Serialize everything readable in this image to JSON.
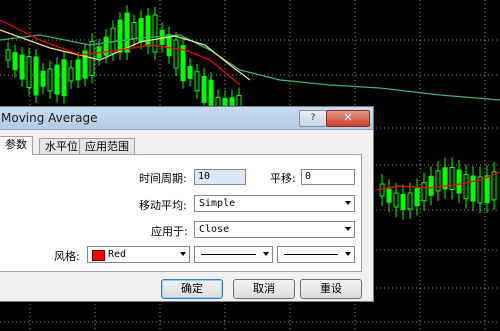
{
  "dialog": {
    "title": "Moving Average",
    "help_label": "?",
    "close_label": "✕",
    "tabs": [
      {
        "label": "参数"
      },
      {
        "label": "水平位"
      },
      {
        "label": "应用范围"
      }
    ],
    "period_label": "时间周期:",
    "period_value": "10",
    "shift_label": "平移:",
    "shift_value": "0",
    "method_label": "移动平均:",
    "method_value": "Simple",
    "apply_label": "应用于:",
    "apply_value": "Close",
    "style_label": "风格:",
    "color_value": "Red",
    "color_hex": "#ff0000",
    "ok_label": "确定",
    "cancel_label": "取消",
    "reset_label": "重设"
  },
  "chart": {
    "background": "#000000",
    "candle_color": "#00ff00",
    "ma_color": "#ff0000",
    "ma2_color": "#f0e68c",
    "ma3_color": "#3cb371",
    "grid_color": "#ffffff"
  }
}
